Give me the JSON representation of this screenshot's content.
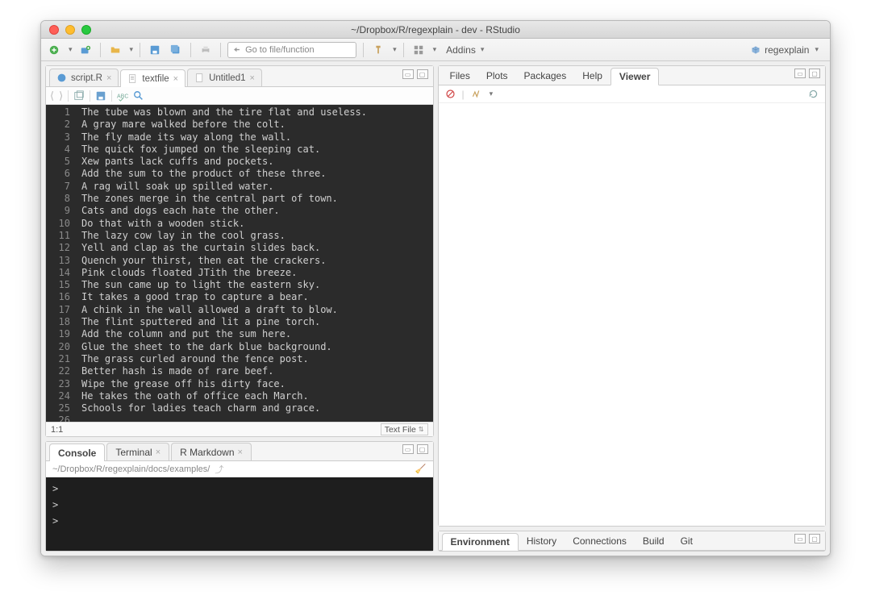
{
  "title": "~/Dropbox/R/regexplain - dev - RStudio",
  "toolbar": {
    "goto_placeholder": "Go to file/function",
    "addins_label": "Addins",
    "project_label": "regexplain"
  },
  "source": {
    "tabs": [
      {
        "label": "script.R",
        "type": "r"
      },
      {
        "label": "textfile",
        "type": "txt",
        "active": true
      },
      {
        "label": "Untitled1",
        "type": "txt"
      }
    ],
    "lines": [
      "The tube was blown and the tire flat and useless.",
      "A gray mare walked before the colt.",
      "The fly made its way along the wall.",
      "The quick fox jumped on the sleeping cat.",
      "Xew pants lack cuffs and pockets.",
      "Add the sum to the product of these three.",
      "A rag will soak up spilled water.",
      "The zones merge in the central part of town.",
      "Cats and dogs each hate the other.",
      "Do that with a wooden stick.",
      "The lazy cow lay in the cool grass.",
      "Yell and clap as the curtain slides back.",
      "Quench your thirst, then eat the crackers.",
      "Pink clouds floated JTith the breeze.",
      "The sun came up to light the eastern sky.",
      "It takes a good trap to capture a bear.",
      "A chink in the wall allowed a draft to blow.",
      "The flint sputtered and lit a pine torch.",
      "Add the column and put the sum here.",
      "Glue the sheet to the dark blue background.",
      "The grass curled around the fence post.",
      "Better hash is made of rare beef.",
      "Wipe the grease off his dirty face.",
      "He takes the oath of office each March.",
      "Schools for ladies teach charm and grace.",
      ""
    ],
    "status": {
      "cursor": "1:1",
      "file_type": "Text File"
    }
  },
  "console": {
    "tabs": [
      "Console",
      "Terminal",
      "R Markdown"
    ],
    "active_tab": "Console",
    "path": "~/Dropbox/R/regexplain/docs/examples/",
    "prompts": [
      ">",
      ">",
      "> "
    ]
  },
  "viewer": {
    "tabs": [
      "Files",
      "Plots",
      "Packages",
      "Help",
      "Viewer"
    ],
    "active_tab": "Viewer"
  },
  "env": {
    "tabs": [
      "Environment",
      "History",
      "Connections",
      "Build",
      "Git"
    ],
    "active_tab": "Environment"
  }
}
